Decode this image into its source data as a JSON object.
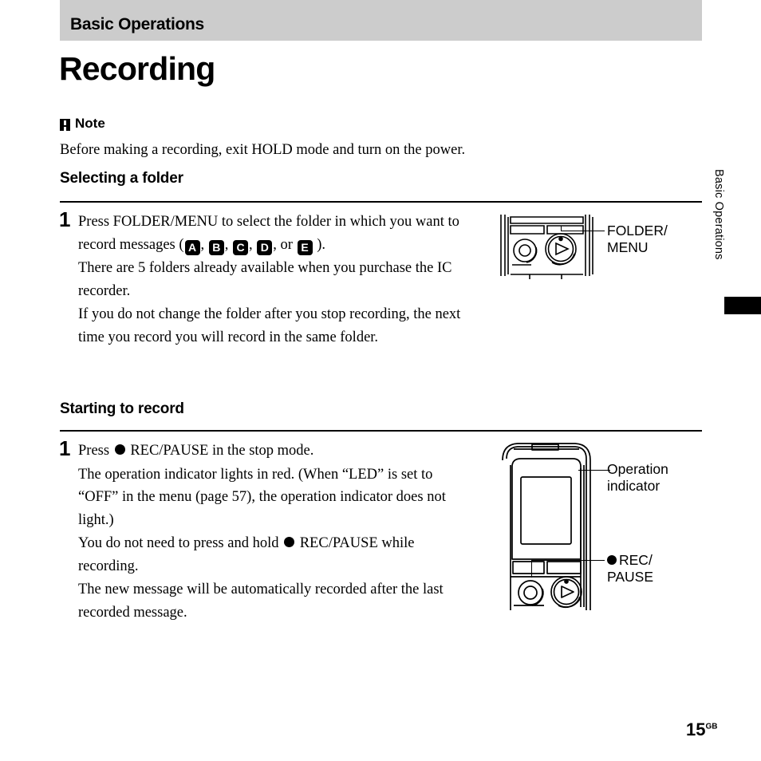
{
  "chapter": {
    "band_title": "Basic Operations",
    "band_color": "#cccccc",
    "side_tab_text": "Basic Operations"
  },
  "section": {
    "title": "Recording"
  },
  "note": {
    "icon": "note-exclamation-icon",
    "heading": "Note",
    "body": "Before making a recording, exit HOLD mode and turn on the power."
  },
  "subsections": [
    {
      "heading": "Selecting a folder",
      "steps": [
        {
          "number": "1",
          "lines": [
            {
              "pre": "Press FOLDER/MENU to select the folder in which you want to record messages (",
              "badges": [
                "A",
                "B",
                "C",
                "D",
                "E"
              ],
              "separator": ", ",
              "or_word": ", or ",
              "post": " )."
            },
            {
              "text": "There are 5 folders already available when you purchase the IC recorder."
            },
            {
              "text": "If you do not change the folder after you stop recording, the next time you record you will record in the same folder."
            }
          ]
        }
      ],
      "callouts": [
        {
          "name": "folder-menu-callout",
          "line1": "FOLDER/",
          "line2": "MENU"
        }
      ]
    },
    {
      "heading": "Starting to record",
      "steps": [
        {
          "number": "1",
          "lines": [
            {
              "pre": "Press ",
              "dot": "●",
              "post": " REC/PAUSE in the stop mode."
            },
            {
              "text": "The operation indicator lights in red. (When “LED” is set to “OFF” in the menu (page 57), the operation indicator does not light.)"
            },
            {
              "pre2": "You do not need to press and hold ",
              "dot2": "●",
              "post2": " REC/PAUSE while recording."
            },
            {
              "text2": "The new message will be automatically recorded after the last recorded message."
            }
          ]
        }
      ],
      "callouts": [
        {
          "name": "operation-indicator-callout",
          "line1": "Operation",
          "line2": "indicator"
        },
        {
          "name": "rec-pause-callout",
          "line1": "REC/",
          "line2": "PAUSE",
          "has_dot": true
        }
      ]
    }
  ],
  "illustrations": [
    {
      "name": "ic-recorder-top-buttons-diagram",
      "alt": "IC recorder detail showing FOLDER/MENU button area"
    },
    {
      "name": "ic-recorder-front-diagram",
      "alt": "IC recorder front showing operation indicator and REC/PAUSE button"
    }
  ],
  "folio": {
    "page_number": "15",
    "region_code": "GB"
  }
}
